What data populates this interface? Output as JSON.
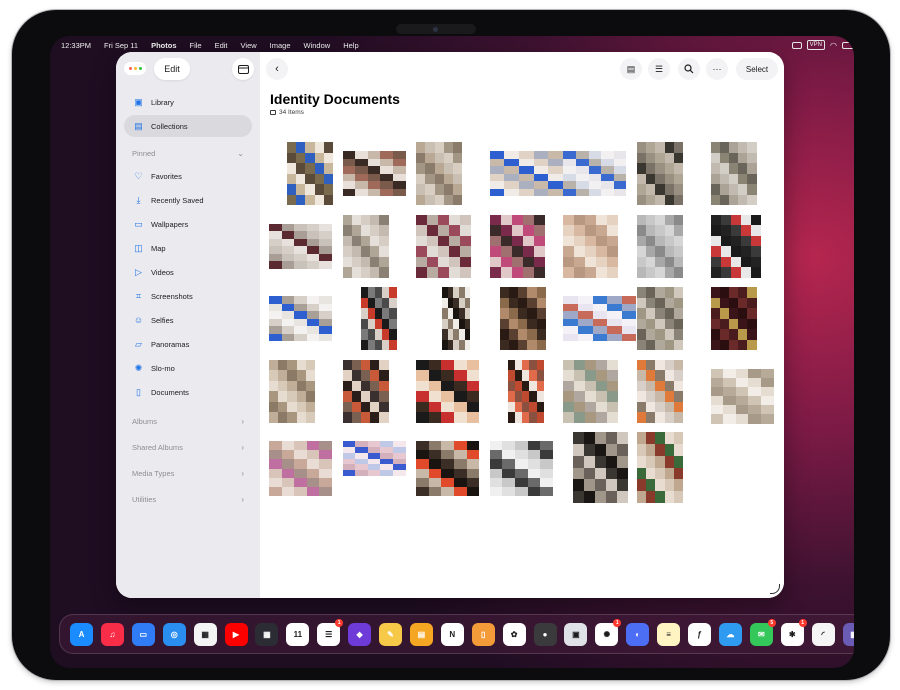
{
  "menubar": {
    "time": "12:33PM",
    "date": "Fri Sep 11",
    "app_name": "Photos",
    "menus": [
      "File",
      "Edit",
      "View",
      "Image",
      "Window",
      "Help"
    ],
    "vpn_label": "VPN"
  },
  "sidebar": {
    "edit_label": "Edit",
    "top_items": [
      {
        "label": "Library",
        "icon": "library-icon"
      },
      {
        "label": "Collections",
        "icon": "collections-icon",
        "active": true
      }
    ],
    "pinned_label": "Pinned",
    "pinned_items": [
      {
        "label": "Favorites",
        "icon": "heart-icon"
      },
      {
        "label": "Recently Saved",
        "icon": "recently-saved-icon"
      },
      {
        "label": "Wallpapers",
        "icon": "wallpapers-icon"
      },
      {
        "label": "Map",
        "icon": "map-icon"
      },
      {
        "label": "Videos",
        "icon": "video-icon"
      },
      {
        "label": "Screenshots",
        "icon": "screenshot-icon"
      },
      {
        "label": "Selfies",
        "icon": "selfie-icon"
      },
      {
        "label": "Panoramas",
        "icon": "panorama-icon"
      },
      {
        "label": "Slo-mo",
        "icon": "slomo-icon"
      },
      {
        "label": "Documents",
        "icon": "document-icon"
      }
    ],
    "sections": [
      "Albums",
      "Shared Albums",
      "Media Types",
      "Utilities"
    ]
  },
  "main": {
    "title": "Identity Documents",
    "item_count": "34 Items",
    "select_label": "Select"
  },
  "dock": {
    "apps": [
      {
        "name": "App Store",
        "color": "#1a8cff",
        "glyph": "A"
      },
      {
        "name": "Music",
        "color": "#fa2d48",
        "glyph": "♫"
      },
      {
        "name": "Files",
        "color": "#2f7cf6",
        "glyph": "▭"
      },
      {
        "name": "Safari",
        "color": "#2a8df0",
        "glyph": "◎"
      },
      {
        "name": "Shortcuts Folder",
        "color": "#f4f4f4",
        "glyph": "▦"
      },
      {
        "name": "YouTube",
        "color": "#ff0000",
        "glyph": "▶"
      },
      {
        "name": "Folder",
        "color": "#2c2c34",
        "glyph": "▦"
      },
      {
        "name": "Calendar",
        "color": "#ffffff",
        "glyph": "11"
      },
      {
        "name": "Reminders",
        "color": "#ffffff",
        "glyph": "☰",
        "badge": "1"
      },
      {
        "name": "Shortcuts",
        "color": "#6e3bd8",
        "glyph": "◆"
      },
      {
        "name": "Notes App",
        "color": "#f7c948",
        "glyph": "✎"
      },
      {
        "name": "Reader",
        "color": "#f5a623",
        "glyph": "▤"
      },
      {
        "name": "Notion",
        "color": "#ffffff",
        "glyph": "N"
      },
      {
        "name": "Orange App",
        "color": "#f29b38",
        "glyph": "▯"
      },
      {
        "name": "Photos",
        "color": "#ffffff",
        "glyph": "✿"
      },
      {
        "name": "Camera",
        "color": "#3a3a3c",
        "glyph": "●"
      },
      {
        "name": "Preview",
        "color": "#dfe3e8",
        "glyph": "▣"
      },
      {
        "name": "ChatGPT",
        "color": "#ffffff",
        "glyph": "✺",
        "badge": "1"
      },
      {
        "name": "Blue Chat",
        "color": "#4c6ef5",
        "glyph": "◐"
      },
      {
        "name": "Notes",
        "color": "#fff4c2",
        "glyph": "≡"
      },
      {
        "name": "Freeform",
        "color": "#ffffff",
        "glyph": "ƒ"
      },
      {
        "name": "Weather",
        "color": "#2e9bf0",
        "glyph": "☁"
      },
      {
        "name": "Messages",
        "color": "#34c759",
        "glyph": "✉",
        "badge": "5"
      },
      {
        "name": "Slack",
        "color": "#ffffff",
        "glyph": "✱",
        "badge": "1"
      },
      {
        "name": "RSS Reader",
        "color": "#f5f5f5",
        "glyph": "◜"
      },
      {
        "name": "App Library",
        "color": "#6a5bb5",
        "glyph": "▦"
      }
    ],
    "calendar_day": "11"
  },
  "thumb_palettes": [
    [
      "#7a6a4e",
      "#c9b79b",
      "#5a4a3a",
      "#2f5fbf",
      "#efe6dc"
    ],
    [
      "#3a2a24",
      "#c8b8aa",
      "#7a5a4a",
      "#e8e0d8",
      "#a06a5a"
    ],
    [
      "#b9a994",
      "#d8cfc2",
      "#8a7b6a",
      "#c9bfb2",
      "#a39684"
    ],
    [
      "#2e5fd0",
      "#e0d2c4",
      "#c8b9a8",
      "#f0ebe6",
      "#aab0c0"
    ],
    [
      "#3a6ad0",
      "#d6dbe6",
      "#e8e6ea",
      "#b8b2aa",
      "#f2f0f0"
    ],
    [
      "#9a9082",
      "#c2b8ac",
      "#7a7266",
      "#b0a696",
      "#3a3630"
    ],
    [
      "#8a8474",
      "#aba496",
      "#d2cec6",
      "#6a655a",
      "#c0bab0"
    ],
    [
      "#5a2a30",
      "#c9c2ba",
      "#e6e1dc",
      "#a89e96",
      "#d6cfc8"
    ],
    [
      "#b0a698",
      "#d6cec4",
      "#8a8074",
      "#e4dfd8",
      "#c4bab0"
    ],
    [
      "#6a2a3a",
      "#9a4a5a",
      "#d0c4bc",
      "#b8aca2",
      "#e2dcd6"
    ],
    [
      "#7a2a4a",
      "#c04a7a",
      "#3a2a2a",
      "#e0c8c8",
      "#a07070"
    ],
    [
      "#d8b8a0",
      "#c8a890",
      "#e6d2c0",
      "#b89880",
      "#f0e4d8"
    ],
    [
      "#b8b8b8",
      "#d6d6d6",
      "#8a8a8a",
      "#c8c8c8",
      "#a8a8a8"
    ],
    [
      "#222222",
      "#c83838",
      "#1a1a1a",
      "#3a3a3a",
      "#e8e8e8"
    ],
    [
      "#2e5fd0",
      "#d6d0c8",
      "#e8e4e0",
      "#a8a096",
      "#f4f2f0"
    ],
    [
      "#1a1a1a",
      "#4a4a4a",
      "#c83a2a",
      "#7a7a7a",
      "#d8d0c8"
    ],
    [
      "#1a1410",
      "#d8cfc4",
      "#f0ece8",
      "#3a2e26",
      "#8a7a6a"
    ],
    [
      "#3a2a20",
      "#5a4030",
      "#8a6a4a",
      "#2a1a14",
      "#b08a6a"
    ],
    [
      "#e8e4f0",
      "#3a7ad0",
      "#c86a5a",
      "#f4f2f6",
      "#a0a8c8"
    ],
    [
      "#8a8478",
      "#b0a89a",
      "#d0c8bc",
      "#6a6458",
      "#a09684"
    ],
    [
      "#3a1418",
      "#6a2a2a",
      "#b89a4a",
      "#2a0e10",
      "#4a1c1e"
    ],
    [
      "#c0ae98",
      "#a8967e",
      "#d8cab8",
      "#8a7a66",
      "#e6dccf"
    ],
    [
      "#3a3030",
      "#c85a3a",
      "#e2d2c4",
      "#7a6050",
      "#2a1e1a"
    ],
    [
      "#1a1a1a",
      "#c83030",
      "#e8c0a0",
      "#3a2a20",
      "#f0e0d0"
    ],
    [
      "#2a1a14",
      "#e06a4a",
      "#c04a30",
      "#f0e6e0",
      "#8a5040"
    ],
    [
      "#c8c0b0",
      "#a89880",
      "#e4ddd2",
      "#8a9a8a",
      "#b0a8a0"
    ],
    [
      "#e07a3a",
      "#f0e8e0",
      "#c8b8a8",
      "#8a7a6a",
      "#d8d0c8"
    ],
    [
      "#d0c4b4",
      "#e6ddd2",
      "#b8aa98",
      "#f2ede6",
      "#a89a88"
    ],
    [
      "#c8a898",
      "#d8c4b8",
      "#a8908a",
      "#e8dcd4",
      "#c070a0"
    ],
    [
      "#3a5ad0",
      "#e8c8d0",
      "#f4e8ec",
      "#d4b0bc",
      "#c0c8e8"
    ],
    [
      "#3a2e26",
      "#c8b8a8",
      "#1a1410",
      "#8a7a6a",
      "#e04a2a"
    ],
    [
      "#f0f0f0",
      "#c8c8c8",
      "#6a6a6a",
      "#e0e0e0",
      "#3a3a3a"
    ],
    [
      "#3a3632",
      "#a0968a",
      "#d0c8be",
      "#1a1614",
      "#6a625a"
    ],
    [
      "#c0a890",
      "#3a6a3a",
      "#d8c8b8",
      "#8a3a2a",
      "#e8dcd0"
    ]
  ]
}
